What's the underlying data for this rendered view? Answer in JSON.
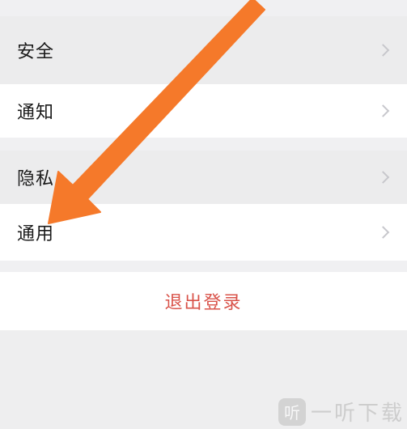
{
  "settings": {
    "items": [
      {
        "label": "安全"
      },
      {
        "label": "通知"
      },
      {
        "label": "隐私"
      },
      {
        "label": "通用"
      }
    ],
    "logout_label": "退出登录"
  },
  "annotation": {
    "arrow_color": "#f5792a",
    "points_to": "通用"
  },
  "watermark": {
    "logo_text": "听",
    "text": "一听下载"
  },
  "colors": {
    "logout_text": "#d9534a",
    "chevron": "#c7c7cc",
    "background": "#eeeeef"
  }
}
